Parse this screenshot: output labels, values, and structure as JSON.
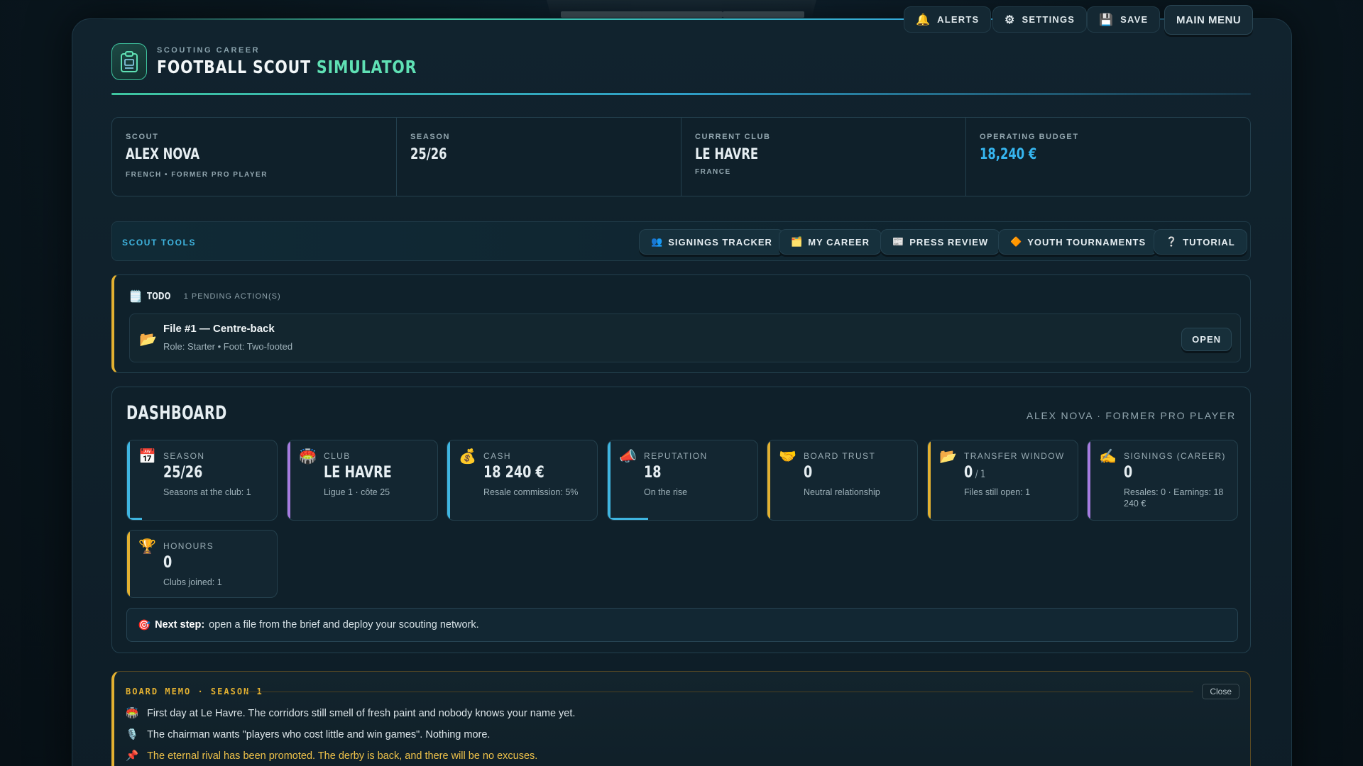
{
  "header": {
    "kicker": "SCOUTING CAREER",
    "title_part1": "FOOTBALL SCOUT",
    "title_part2": "SIMULATOR",
    "buttons": [
      {
        "icon": "bell-icon",
        "glyph": "🔔",
        "label": "ALERTS"
      },
      {
        "icon": "gear-icon",
        "glyph": "⚙",
        "label": "SETTINGS"
      },
      {
        "icon": "floppy-icon",
        "glyph": "💾",
        "label": "SAVE"
      }
    ],
    "main_menu": "MAIN MENU"
  },
  "info": {
    "scout_label": "SCOUT",
    "scout_name": "ALEX NOVA",
    "scout_sub": "FRENCH • FORMER PRO PLAYER",
    "season_label": "SEASON",
    "season_value": "25/26",
    "club_label": "CURRENT CLUB",
    "club_value": "LE HAVRE",
    "club_sub": "FRANCE",
    "budget_label": "OPERATING BUDGET",
    "budget_value": "18,240 €"
  },
  "tools": {
    "label": "SCOUT TOOLS",
    "buttons": [
      {
        "glyph": "👥",
        "label": "SIGNINGS TRACKER"
      },
      {
        "glyph": "🗂️",
        "label": "MY CAREER"
      },
      {
        "glyph": "📰",
        "label": "PRESS REVIEW"
      },
      {
        "glyph": "🔶",
        "label": "YOUTH TOURNAMENTS"
      },
      {
        "glyph": "❔",
        "label": "TUTORIAL"
      }
    ]
  },
  "todo": {
    "glyph": "🗒️",
    "title": "TODO",
    "count": "1 PENDING ACTION(S)",
    "item_title": "File #1 — Centre-back",
    "item_sub": "Role: Starter • Foot: Two-footed",
    "open": "OPEN"
  },
  "dashboard": {
    "title": "DASHBOARD",
    "subtitle": "ALEX NOVA · FORMER PRO PLAYER",
    "cards": [
      {
        "glyph": "📅",
        "label": "SEASON",
        "value": "25/26",
        "value_small": "",
        "sub": "Seasons at the club: 1",
        "accent": "#3fb5e0",
        "progress": 0.1
      },
      {
        "glyph": "🏟️",
        "label": "CLUB",
        "value": "LE HAVRE",
        "value_small": "",
        "sub": "Ligue 1 · côte 25",
        "accent": "#a77be0",
        "progress": 0
      },
      {
        "glyph": "💰",
        "label": "CASH",
        "value": "18 240 €",
        "value_small": "",
        "sub": "Resale commission: 5%",
        "accent": "#3fb5e0",
        "progress": 0
      },
      {
        "glyph": "📣",
        "label": "REPUTATION",
        "value": "18",
        "value_small": "",
        "sub": "On the rise",
        "accent": "#3fb5e0",
        "progress": 0.27
      },
      {
        "glyph": "🤝",
        "label": "BOARD TRUST",
        "value": "0",
        "value_small": "",
        "sub": "Neutral relationship",
        "accent": "#e3b131",
        "progress": 0
      },
      {
        "glyph": "📂",
        "label": "TRANSFER WINDOW",
        "value": "0",
        "value_small": " / 1",
        "sub": "Files still open: 1",
        "accent": "#e3b131",
        "progress": 0
      },
      {
        "glyph": "✍️",
        "label": "SIGNINGS (CAREER)",
        "value": "0",
        "value_small": "",
        "sub": "Resales: 0 · Earnings: 18 240 €",
        "accent": "#a77be0",
        "progress": 0
      },
      {
        "glyph": "🏆",
        "label": "HONOURS",
        "value": "0",
        "value_small": "",
        "sub": "Clubs joined: 1",
        "accent": "#e3b131",
        "progress": 0
      }
    ],
    "next_glyph": "🎯",
    "next_bold": "Next step:",
    "next_text": "open a file from the brief and deploy your scouting network."
  },
  "memo": {
    "title": "BOARD MEMO · SEASON 1",
    "close": "Close",
    "lines": [
      {
        "glyph": "🏟️",
        "text": "First day at Le Havre. The corridors still smell of fresh paint and nobody knows your name yet.",
        "warn": false
      },
      {
        "glyph": "🎙️",
        "text": "The chairman wants \"players who cost little and win games\". Nothing more.",
        "warn": false
      },
      {
        "glyph": "📌",
        "text": "The eternal rival has been promoted. The derby is back, and there will be no excuses.",
        "warn": true
      }
    ]
  }
}
